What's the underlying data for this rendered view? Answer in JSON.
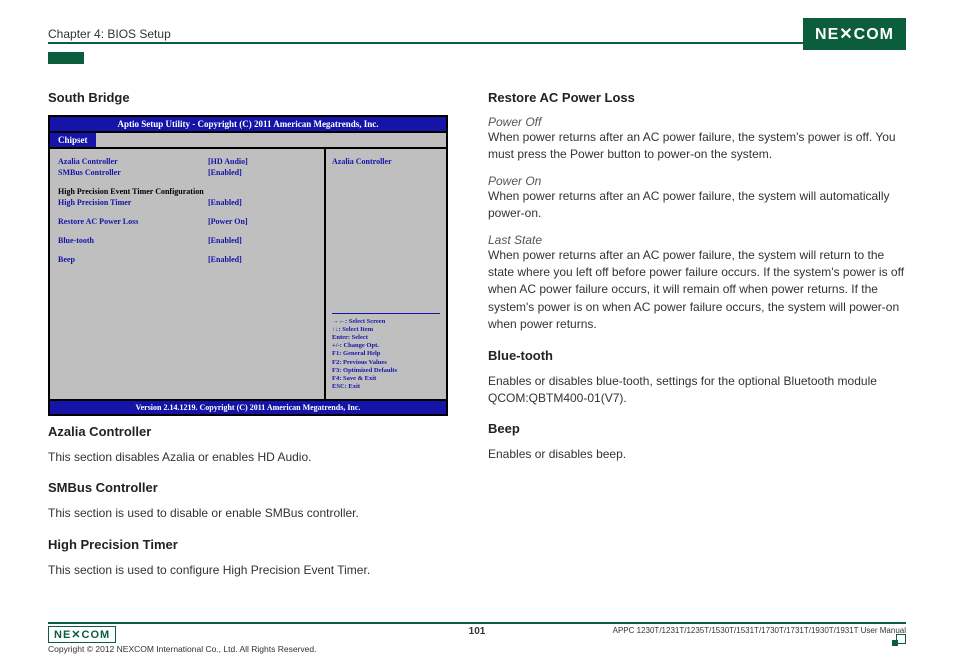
{
  "header": {
    "chapter": "Chapter 4: BIOS Setup",
    "logo": "NE COM"
  },
  "left": {
    "title": "South Bridge",
    "bios": {
      "title_bar": "Aptio Setup Utility - Copyright (C) 2011 American Megatrends, Inc.",
      "tab": "Chipset",
      "rows": [
        {
          "label": "Azalia Controller",
          "value": "[HD Audio]",
          "black": false
        },
        {
          "label": "SMBus Controller",
          "value": "[Enabled]",
          "black": false
        },
        {
          "label": "High Precision Event Timer Configuration",
          "value": "",
          "black": true
        },
        {
          "label": "High Precision Timer",
          "value": "[Enabled]",
          "black": false
        },
        {
          "label": "Restore AC Power Loss",
          "value": "[Power On]",
          "black": false
        },
        {
          "label": "Blue-tooth",
          "value": "[Enabled]",
          "black": false
        },
        {
          "label": "Beep",
          "value": "[Enabled]",
          "black": false
        }
      ],
      "side_title": "Azalia Controller",
      "help": [
        "→←: Select Screen",
        "↑↓: Select Item",
        "Enter: Select",
        "+/-: Change Opt.",
        "F1: General Help",
        "F2: Previous Values",
        "F3: Optimized Defaults",
        "F4: Save & Exit",
        "ESC: Exit"
      ],
      "footer": "Version 2.14.1219. Copyright (C) 2011 American Megatrends, Inc."
    },
    "sections": [
      {
        "heading": "Azalia Controller",
        "text": "This section disables Azalia or enables HD Audio."
      },
      {
        "heading": "SMBus Controller",
        "text": "This section is used to disable or enable SMBus controller."
      },
      {
        "heading": "High Precision Timer",
        "text": "This section is used to configure High Precision Event Timer."
      }
    ]
  },
  "right": {
    "restore": {
      "heading": "Restore AC Power Loss",
      "items": [
        {
          "sub": "Power Off",
          "text": "When power returns after an AC power failure, the system's power is off. You must press the Power button to power-on the system."
        },
        {
          "sub": "Power On",
          "text": "When power returns after an AC power failure, the system will automatically power-on."
        },
        {
          "sub": "Last State",
          "text": "When power returns after an AC power failure, the system will return to the state where you left off before power failure occurs. If the system's power is off when AC power failure occurs, it will remain off when power returns. If the system's power is on when AC power failure occurs, the system will power-on when power returns."
        }
      ]
    },
    "bluetooth": {
      "heading": "Blue-tooth",
      "text": "Enables or disables blue-tooth, settings for the optional Bluetooth module QCOM:QBTM400-01(V7)."
    },
    "beep": {
      "heading": "Beep",
      "text": "Enables or disables beep."
    }
  },
  "footer": {
    "logo": "NE COM",
    "copyright": "Copyright © 2012 NEXCOM International Co., Ltd. All Rights Reserved.",
    "page": "101",
    "manual": "APPC 1230T/1231T/1235T/1530T/1531T/1730T/1731T/1930T/1931T User Manual"
  }
}
